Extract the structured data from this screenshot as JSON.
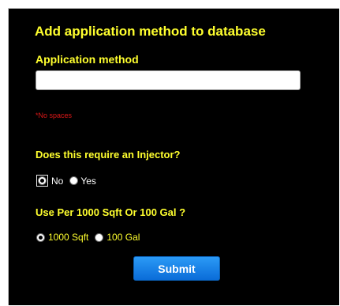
{
  "form": {
    "title": "Add application method to database",
    "method_label": "Application method",
    "method_value": "",
    "method_placeholder": "",
    "hint": "*No spaces",
    "injector": {
      "question": "Does this require an Injector?",
      "options": [
        "No",
        "Yes"
      ],
      "selected": "No"
    },
    "usage": {
      "question": "Use Per 1000 Sqft Or 100 Gal ?",
      "options": [
        "1000 Sqft",
        "100 Gal"
      ],
      "selected": "1000 Sqft"
    },
    "submit_label": "Submit"
  },
  "colors": {
    "background": "#000000",
    "heading": "#ffff2e",
    "hint": "#e01818",
    "button": "#1584ea"
  }
}
